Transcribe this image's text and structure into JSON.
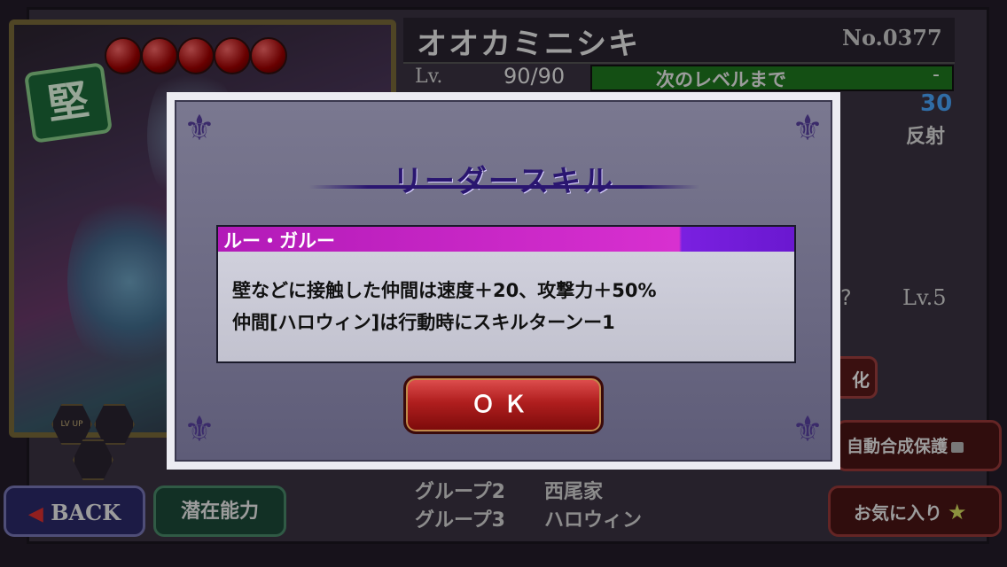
{
  "character": {
    "name": "オオカミニシキ",
    "number": "No.0377",
    "badge": "堅",
    "lv_label": "Lv.",
    "lv_value": "90/90",
    "next_level_label": "次のレベルまで",
    "next_level_value": "-",
    "stat_value": "30",
    "hit_type": "反射",
    "skill_level": "Lv.5",
    "q_mark": "?",
    "ka_label": "化",
    "lvup_label": "LV UP",
    "groups": [
      {
        "label": "グループ2",
        "value": "西尾家"
      },
      {
        "label": "グループ3",
        "value": "ハロウィン"
      }
    ]
  },
  "buttons": {
    "back": "BACK",
    "latent": "潜在能力",
    "auto_protect": "自動合成保護",
    "favorite": "お気に入り"
  },
  "modal": {
    "title": "リーダースキル",
    "skill_name": "ルー・ガルー",
    "lines": [
      "壁などに接触した仲間は速度＋20、攻撃力＋50%",
      "仲間[ハロウィン]は行動時にスキルターンー1"
    ],
    "ok_label": "ＯＫ"
  },
  "colors": {
    "skill_header": "#c824c4",
    "ok_button": "#b01e1e",
    "next_bar": "#1f7a1f",
    "stat_blue": "#4aa8ff"
  }
}
